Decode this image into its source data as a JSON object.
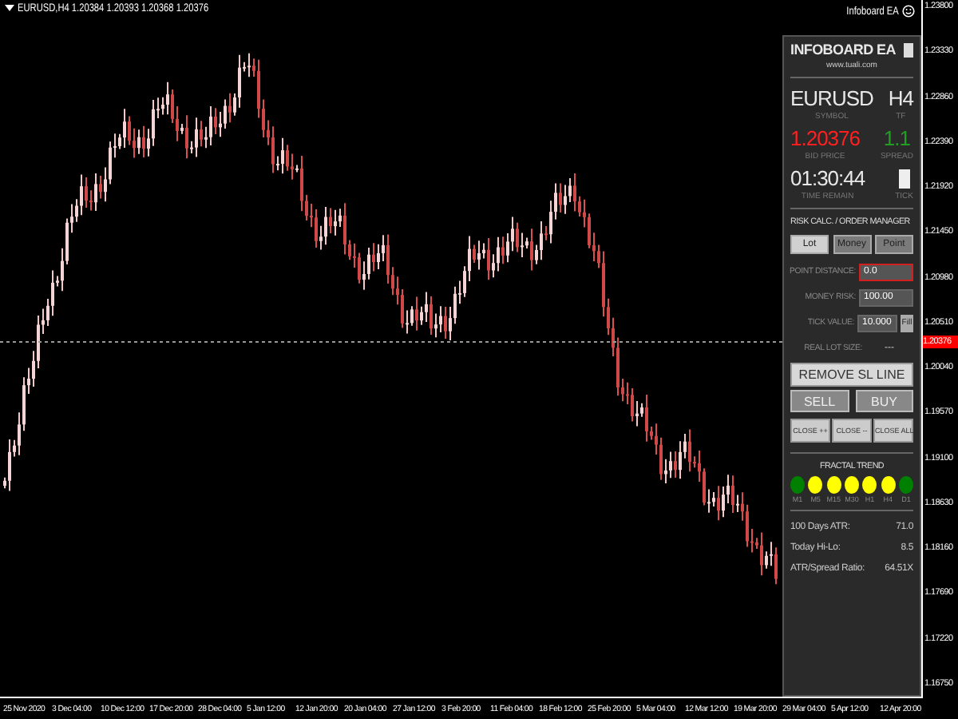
{
  "chart": {
    "header": "EURUSD,H4 1.20384 1.20393 1.20368 1.20376",
    "expert_label": "Infoboard EA",
    "price_axis": [
      "1.23800",
      "1.23330",
      "1.22860",
      "1.22390",
      "1.21920",
      "1.21450",
      "1.20980",
      "1.20510",
      "1.20040",
      "1.19570",
      "1.19100",
      "1.18630",
      "1.18160",
      "1.17690",
      "1.17220",
      "1.16750"
    ],
    "current_price": "1.20376",
    "time_axis": [
      "25 Nov 2020",
      "3 Dec 04:00",
      "10 Dec 12:00",
      "17 Dec 20:00",
      "28 Dec 04:00",
      "5 Jan 12:00",
      "12 Jan 20:00",
      "20 Jan 04:00",
      "27 Jan 12:00",
      "3 Feb 20:00",
      "11 Feb 04:00",
      "18 Feb 12:00",
      "25 Feb 20:00",
      "5 Mar 04:00",
      "12 Mar 12:00",
      "19 Mar 20:00",
      "29 Mar 04:00",
      "5 Apr 12:00",
      "12 Apr 20:00"
    ]
  },
  "panel": {
    "title": "INFOBOARD EA",
    "url": "www.tuali.com",
    "symbol": {
      "value": "EURUSD",
      "label": "SYMBOL"
    },
    "timeframe": {
      "value": "H4",
      "label": "TF"
    },
    "bid": {
      "value": "1.20376",
      "label": "BID PRICE"
    },
    "spread": {
      "value": "1.1",
      "label": "SPREAD"
    },
    "time_remain": {
      "value": "01:30:44",
      "label": "TIME REMAIN"
    },
    "tick": {
      "label": "TICK"
    },
    "section_title": "RISK CALC. / ORDER MANAGER",
    "modes": [
      {
        "label": "Lot",
        "selected": true
      },
      {
        "label": "Money",
        "selected": false
      },
      {
        "label": "Point",
        "selected": false
      }
    ],
    "fields": [
      {
        "label": "POINT DISTANCE:",
        "value": "0.0",
        "highlighted": true
      },
      {
        "label": "MONEY RISK:",
        "value": "100.00",
        "highlighted": false
      },
      {
        "label": "TICK VALUE:",
        "value": "10.000",
        "highlighted": false,
        "button": "Fill"
      }
    ],
    "lot_size": {
      "label": "REAL LOT SIZE:",
      "value": "---"
    },
    "remove_button": "REMOVE SL LINE",
    "trade_buttons": [
      "SELL",
      "BUY"
    ],
    "close_buttons": [
      "CLOSE ++",
      "CLOSE --",
      "CLOSE ALL"
    ],
    "trend_title": "FRACTAL TREND",
    "trend": [
      {
        "label": "M1",
        "color": "#008000"
      },
      {
        "label": "M5",
        "color": "#ffff00"
      },
      {
        "label": "M15",
        "color": "#ffff00"
      },
      {
        "label": "M30",
        "color": "#ffff00"
      },
      {
        "label": "H1",
        "color": "#ffff00"
      },
      {
        "label": "H4",
        "color": "#ffff00"
      },
      {
        "label": "D1",
        "color": "#008000"
      }
    ],
    "stats": [
      {
        "label": "100 Days ATR:",
        "value": "71.0"
      },
      {
        "label": "Today Hi-Lo:",
        "value": "8.5"
      },
      {
        "label": "ATR/Spread Ratio:",
        "value": "64.51X"
      }
    ]
  }
}
